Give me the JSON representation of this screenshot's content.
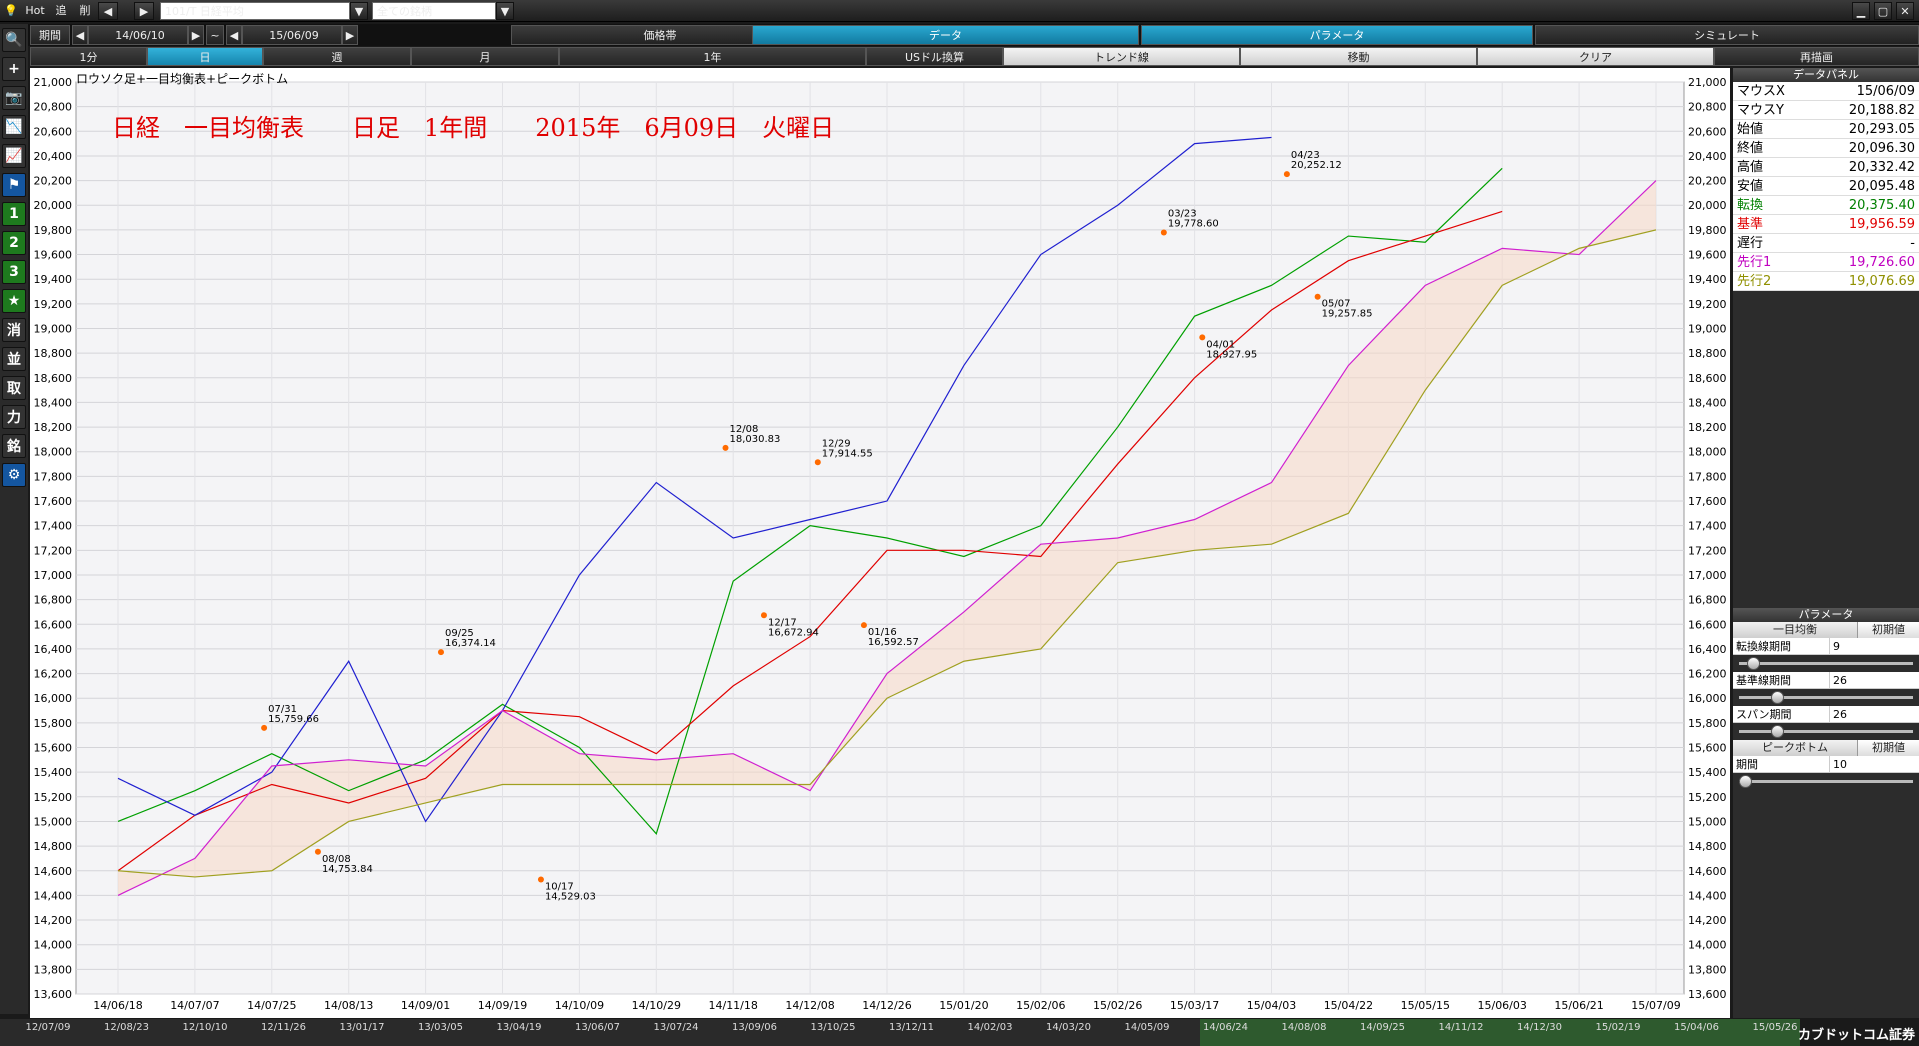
{
  "topbar": {
    "hot_label": "Hot",
    "add_label": "追",
    "del_label": "削",
    "prev_label": "◀",
    "next_label": "▶",
    "symbol_value": "101/T 日経平均",
    "list_value": "全ての銘柄"
  },
  "period": {
    "label": "期間",
    "from": "14/06/10",
    "tilde": "~",
    "to": "15/06/09"
  },
  "main_tabs": [
    {
      "label": "価格帯",
      "selected": false
    },
    {
      "label": "データ",
      "selected": true
    },
    {
      "label": "パラメータ",
      "selected": true
    },
    {
      "label": "シミュレート",
      "selected": false
    }
  ],
  "period_tabs": [
    {
      "label": "1分",
      "selected": false
    },
    {
      "label": "日",
      "selected": true
    },
    {
      "label": "週",
      "selected": false
    },
    {
      "label": "月",
      "selected": false
    },
    {
      "label": "1年",
      "selected": false
    },
    {
      "label": "USドル換算",
      "selected": false
    },
    {
      "label": "トレンド線",
      "light": true
    },
    {
      "label": "移動",
      "light": true
    },
    {
      "label": "クリア",
      "light": true
    },
    {
      "label": "再描画",
      "selected": false
    }
  ],
  "sidebar_icons": [
    {
      "name": "search-icon",
      "glyph": "🔍"
    },
    {
      "name": "crosshair-icon",
      "glyph": "+"
    },
    {
      "name": "camera-icon",
      "glyph": "📷"
    },
    {
      "name": "chart-red-icon",
      "glyph": "📉"
    },
    {
      "name": "chart-purple-icon",
      "glyph": "📈"
    },
    {
      "name": "flag-icon",
      "glyph": "⚑"
    },
    {
      "name": "one-icon",
      "glyph": "1"
    },
    {
      "name": "two-icon",
      "glyph": "2"
    },
    {
      "name": "three-icon",
      "glyph": "3"
    },
    {
      "name": "star-icon",
      "glyph": "★"
    },
    {
      "name": "erase-icon",
      "glyph": "消"
    },
    {
      "name": "kanji-icon-1",
      "glyph": "並"
    },
    {
      "name": "kanji-icon-2",
      "glyph": "取"
    },
    {
      "name": "kanji-icon-3",
      "glyph": "力"
    },
    {
      "name": "kanji-icon-4",
      "glyph": "銘"
    },
    {
      "name": "gear-icon",
      "glyph": "⚙"
    }
  ],
  "chart": {
    "legend": "ロウソク足+一目均衡表+ピークボトム",
    "title": "日経　一目均衡表　　日足　1年間　　2015年　6月09日　火曜日",
    "yticks": [
      "21,000",
      "20,800",
      "20,600",
      "20,400",
      "20,200",
      "20,000",
      "19,800",
      "19,600",
      "19,400",
      "19,200",
      "19,000",
      "18,800",
      "18,600",
      "18,400",
      "18,200",
      "18,000",
      "17,800",
      "17,600",
      "17,400",
      "17,200",
      "17,000",
      "16,800",
      "16,600",
      "16,400",
      "16,200",
      "16,000",
      "15,800",
      "15,600",
      "15,400",
      "15,200",
      "15,000",
      "14,800",
      "14,600",
      "14,400",
      "14,200",
      "14,000",
      "13,800",
      "13,600"
    ],
    "xticks": [
      "14/06/18",
      "14/07/07",
      "14/07/25",
      "14/08/13",
      "14/09/01",
      "14/09/19",
      "14/10/09",
      "14/10/29",
      "14/11/18",
      "14/12/08",
      "14/12/26",
      "15/01/20",
      "15/02/06",
      "15/02/26",
      "15/03/17",
      "15/04/03",
      "15/04/22",
      "15/05/15",
      "15/06/03",
      "15/06/21",
      "15/07/09"
    ],
    "peaks": [
      {
        "date": "07/31",
        "value": "15,759.66"
      },
      {
        "date": "08/08",
        "value": "14,753.84"
      },
      {
        "date": "09/25",
        "value": "16,374.14"
      },
      {
        "date": "10/17",
        "value": "14,529.03"
      },
      {
        "date": "12/08",
        "value": "18,030.83"
      },
      {
        "date": "12/17",
        "value": "16,672.94"
      },
      {
        "date": "12/29",
        "value": "17,914.55"
      },
      {
        "date": "01/16",
        "value": "16,592.57"
      },
      {
        "date": "03/23",
        "value": "19,778.60"
      },
      {
        "date": "04/01",
        "value": "18,927.95"
      },
      {
        "date": "04/23",
        "value": "20,252.12"
      },
      {
        "date": "05/07",
        "value": "19,257.85"
      }
    ]
  },
  "chart_data": {
    "type": "line",
    "title": "日経　一目均衡表　　日足　1年間　　2015年　6月09日　火曜日",
    "xlabel": "",
    "ylabel": "",
    "ylim": [
      13600,
      21000
    ],
    "x": [
      "14/06/18",
      "14/07/07",
      "14/07/25",
      "14/08/13",
      "14/09/01",
      "14/09/19",
      "14/10/09",
      "14/10/29",
      "14/11/18",
      "14/12/08",
      "14/12/26",
      "15/01/20",
      "15/02/06",
      "15/02/26",
      "15/03/17",
      "15/04/03",
      "15/04/22",
      "15/05/15",
      "15/06/03",
      "15/06/21",
      "15/07/09"
    ],
    "series": [
      {
        "name": "転換",
        "color": "#00a000",
        "values": [
          15000,
          15250,
          15550,
          15250,
          15500,
          15950,
          15600,
          14900,
          16950,
          17400,
          17300,
          17150,
          17400,
          18200,
          19100,
          19350,
          19750,
          19700,
          20300,
          null,
          null
        ]
      },
      {
        "name": "基準",
        "color": "#e00000",
        "values": [
          14600,
          15050,
          15300,
          15150,
          15350,
          15900,
          15850,
          15550,
          16100,
          16500,
          17200,
          17200,
          17150,
          17900,
          18600,
          19150,
          19550,
          19750,
          19950,
          null,
          null
        ]
      },
      {
        "name": "遅行",
        "color": "#2020d0",
        "values": [
          15350,
          15050,
          15400,
          16300,
          15000,
          15900,
          17000,
          17750,
          17300,
          17450,
          17600,
          18700,
          19600,
          20000,
          20500,
          20550,
          null,
          null,
          null,
          null,
          null
        ]
      },
      {
        "name": "先行1",
        "color": "#d020d0",
        "values": [
          14400,
          14700,
          15450,
          15500,
          15450,
          15900,
          15550,
          15500,
          15550,
          15250,
          16200,
          16700,
          17250,
          17300,
          17450,
          17750,
          18700,
          19350,
          19650,
          19600,
          20200
        ]
      },
      {
        "name": "先行2",
        "color": "#a0a020",
        "values": [
          14600,
          14550,
          14600,
          15000,
          15150,
          15300,
          15300,
          15300,
          15300,
          15300,
          16000,
          16300,
          16400,
          17100,
          17200,
          17250,
          17500,
          18500,
          19350,
          19650,
          19800
        ]
      }
    ]
  },
  "data_panel": {
    "title": "データパネル",
    "rows": [
      {
        "label": "マウスX",
        "value": "15/06/09",
        "color": "#000"
      },
      {
        "label": "マウスY",
        "value": "20,188.82",
        "color": "#000"
      },
      {
        "label": "始値",
        "value": "20,293.05",
        "color": "#000"
      },
      {
        "label": "終値",
        "value": "20,096.30",
        "color": "#000"
      },
      {
        "label": "高値",
        "value": "20,332.42",
        "color": "#000"
      },
      {
        "label": "安値",
        "value": "20,095.48",
        "color": "#000"
      },
      {
        "label": "転換",
        "value": "20,375.40",
        "color": "#008000"
      },
      {
        "label": "基準",
        "value": "19,956.59",
        "color": "#e00000"
      },
      {
        "label": "遅行",
        "value": "-",
        "color": "#000"
      },
      {
        "label": "先行1",
        "value": "19,726.60",
        "color": "#c000c0"
      },
      {
        "label": "先行2",
        "value": "19,076.69",
        "color": "#909000"
      }
    ]
  },
  "param_panel": {
    "title": "パラメータ",
    "sections": [
      {
        "title": "一目均衡",
        "reset": "初期値",
        "params": [
          {
            "label": "転換線期間",
            "value": "9",
            "level": 0.05
          },
          {
            "label": "基準線期間",
            "value": "26",
            "level": 0.2
          },
          {
            "label": "スパン期間",
            "value": "26",
            "level": 0.2
          }
        ]
      },
      {
        "title": "ピークボトム",
        "reset": "初期値",
        "params": [
          {
            "label": "期間",
            "value": "10",
            "level": 0.0
          }
        ]
      }
    ]
  },
  "bottom_nav": {
    "labels": [
      "12/07/09",
      "12/08/23",
      "12/10/10",
      "12/11/26",
      "13/01/17",
      "13/03/05",
      "13/04/19",
      "13/06/07",
      "13/07/24",
      "13/09/06",
      "13/10/25",
      "13/12/11",
      "14/02/03",
      "14/03/20",
      "14/05/09",
      "14/06/24",
      "14/08/08",
      "14/09/25",
      "14/11/12",
      "14/12/30",
      "15/02/19",
      "15/04/06",
      "15/05/26"
    ],
    "brand": "カブドットコム証券"
  }
}
